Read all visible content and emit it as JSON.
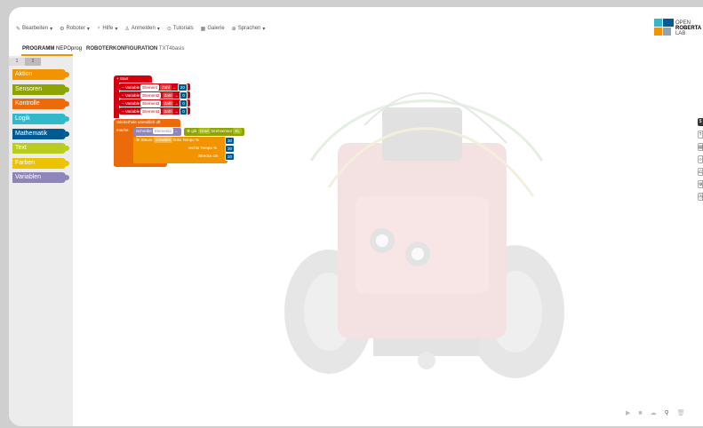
{
  "menu": {
    "items": [
      {
        "icon": "pencil-icon",
        "label": "Bearbeiten",
        "glyph": "✎"
      },
      {
        "icon": "robot-icon",
        "label": "Roboter",
        "glyph": "⚙"
      },
      {
        "icon": "lightbulb-icon",
        "label": "Hilfe",
        "glyph": "♀"
      },
      {
        "icon": "user-icon",
        "label": "Anmelden",
        "glyph": "♙"
      },
      {
        "icon": "tutorial-icon",
        "label": "Tutorials",
        "glyph": "⊙"
      },
      {
        "icon": "gallery-icon",
        "label": "Galerie",
        "glyph": "▦"
      },
      {
        "icon": "language-icon",
        "label": "Sprachen",
        "glyph": "⊕"
      }
    ],
    "chevron": "▾"
  },
  "tabs": {
    "program_label": "PROGRAMM",
    "program_name": "NEPOprog",
    "config_label": "ROBOTERKONFIGURATION",
    "config_name": "TXT4basis"
  },
  "logo": {
    "line1": "OPEN",
    "line2": "ROBERTA",
    "line3": "LAB",
    "colors": [
      "#33b8ca",
      "#005a94",
      "#f29400",
      "#8fa4b0"
    ]
  },
  "toolbox": {
    "level_tabs": [
      "1",
      "2"
    ],
    "categories": [
      {
        "label": "Aktion",
        "color": "#f29400"
      },
      {
        "label": "Sensoren",
        "color": "#8fa402"
      },
      {
        "label": "Kontrolle",
        "color": "#eb6a0a"
      },
      {
        "label": "Logik",
        "color": "#33b8ca"
      },
      {
        "label": "Mathematik",
        "color": "#005a94"
      },
      {
        "label": "Text",
        "color": "#bacc1e"
      },
      {
        "label": "Farben",
        "color": "#ebc300"
      },
      {
        "label": "Variablen",
        "color": "#9085ba"
      }
    ]
  },
  "program": {
    "start_label": "Start",
    "variables": [
      {
        "keyword": "Variable",
        "name": "Element",
        "type": "Zahl",
        "value": "20"
      },
      {
        "keyword": "Variable",
        "name": "Element2",
        "type": "Zahl",
        "value": "0"
      },
      {
        "keyword": "Variable",
        "name": "Element3",
        "type": "Zahl",
        "value": "0"
      },
      {
        "keyword": "Variable",
        "name": "Element4",
        "type": "Zahl",
        "value": "0"
      }
    ],
    "loop_label": "Wiederhole unendlich oft",
    "do_label": "mache",
    "assign_label": "Schreibe",
    "assign_var": "Element2",
    "get_label": "gib",
    "get_unit": "Grad",
    "gyro_label": "Drehsensor",
    "gyro_port": "EL",
    "steer_label": "Steure",
    "steer_dir": "vorwärts",
    "left_speed_label": "links Tempo %",
    "right_speed_label": "rechts Tempo %",
    "distance_label": "Strecke cm",
    "left_speed": "30",
    "right_speed": "30",
    "distance": "20",
    "assign_arrow": "←",
    "gear_icon": "⚙"
  },
  "side_tools": [
    "$",
    "?",
    "▤",
    "‹›",
    "⎌",
    "⚙",
    "Ⓐ"
  ],
  "bottom_tools": [
    "▶",
    "■",
    "☁",
    "⚲",
    "🗑"
  ]
}
